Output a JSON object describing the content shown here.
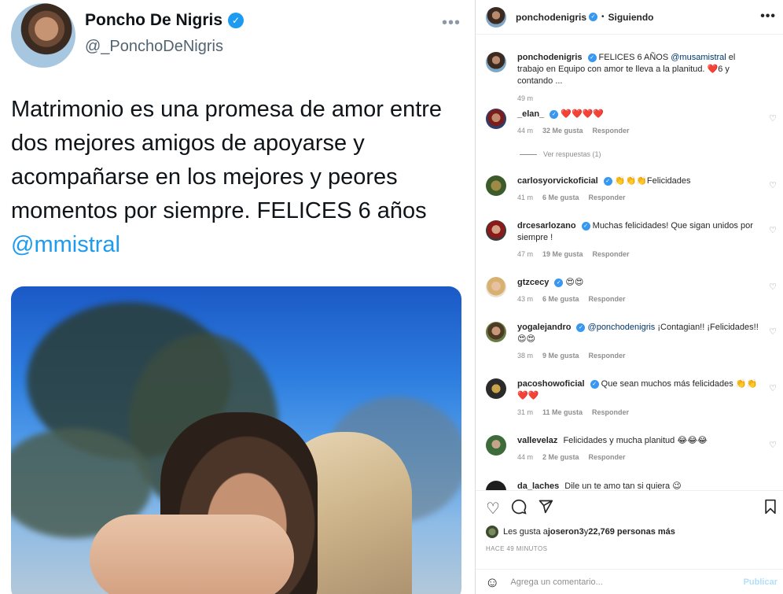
{
  "tweet": {
    "name": "Poncho De Nigris",
    "handle": "@_PonchoDeNigris",
    "more": "•••",
    "text_main": "Matrimonio es una promesa de amor entre dos mejores amigos de apoyarse y acompañarse en los mejores y peores momentos por siempre. FELICES 6 años ",
    "mention": "@mmistral"
  },
  "instagram": {
    "header": {
      "username": "ponchodenigris",
      "separator": "•",
      "following": "Siguiendo",
      "more": "•••"
    },
    "caption": {
      "username": "ponchodenigris",
      "text_before": " FELICES 6 AÑOS ",
      "mention": "@musamistral",
      "text_after": " el trabajo en Equipo con amor te lleva a la planitud. ❤️6 y contando ...",
      "time": "49 m"
    },
    "comments": [
      {
        "username": "_elan_",
        "text": "❤️❤️❤️❤️",
        "time": "44 m",
        "likes": "32 Me gusta",
        "reply": "Responder"
      },
      {
        "username": "carlosyorvickoficial",
        "text": "👏👏👏Felicidades",
        "time": "41 m",
        "likes": "6 Me gusta",
        "reply": "Responder"
      },
      {
        "username": "drcesarlozano",
        "text": "Muchas felicidades! Que sigan unidos por siempre !",
        "time": "47 m",
        "likes": "19 Me gusta",
        "reply": "Responder"
      },
      {
        "username": "gtzcecy",
        "text": "😍😍",
        "time": "43 m",
        "likes": "6 Me gusta",
        "reply": "Responder"
      },
      {
        "username": "yogalejandro",
        "mention": "@ponchodenigris",
        "text": " ¡Contagian!! ¡Felicidades!! 😍😍",
        "time": "38 m",
        "likes": "9 Me gusta",
        "reply": "Responder"
      },
      {
        "username": "pacoshowoficial",
        "text": "Que sean muchos más felicidades 👏👏❤️❤️",
        "time": "31 m",
        "likes": "11 Me gusta",
        "reply": "Responder"
      },
      {
        "username": "vallevelaz",
        "text": "Felicidades y mucha planitud 😂😂😂",
        "time": "44 m",
        "likes": "2 Me gusta",
        "reply": "Responder"
      },
      {
        "username": "da_laches",
        "text": "Dile un te amo tan si quiera 😉"
      }
    ],
    "view_replies": "Ver respuestas (1)",
    "likes_text_prefix": "Les gusta a ",
    "likes_user": "joseron3",
    "likes_text_mid": " y ",
    "likes_count": "22,769 personas más",
    "time_ago": "HACE 49 MINUTOS",
    "comment_placeholder": "Agrega un comentario...",
    "publish": "Publicar"
  },
  "icons": [
    "verified-icon",
    "more-icon",
    "heart-icon",
    "comment-icon",
    "share-icon",
    "bookmark-icon",
    "emoji-icon"
  ],
  "colors": {
    "twitter_blue": "#1d9bf0",
    "ig_link": "#00376b",
    "ig_verified": "#3897f0",
    "heart_red": "#ed4956"
  }
}
